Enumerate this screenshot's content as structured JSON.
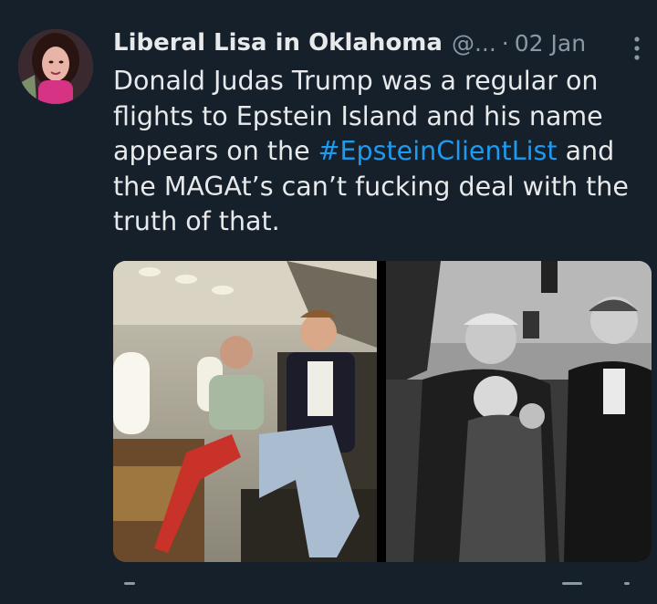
{
  "tweet": {
    "display_name": "Liberal Lisa in Oklahoma",
    "handle": "@...",
    "separator": "·",
    "date": "02 Jan",
    "text_lines": [
      "Donald Judas Trump was a regular on",
      "flights to Epstein Island and his name",
      "appears on the ",
      "#EpsteinClientList",
      " and",
      "the MAGAt’s can’t fucking deal with the",
      "truth of that."
    ]
  },
  "icons": {
    "avatar": "avatar-photo",
    "more": "more-options-icon",
    "actions": [
      "reply-icon",
      "retweet-icon",
      "like-icon",
      "share-icon"
    ]
  },
  "colors": {
    "background": "#15202b",
    "text": "#e7e9ea",
    "secondary": "#8b98a5",
    "hashtag": "#1d9bf0"
  }
}
